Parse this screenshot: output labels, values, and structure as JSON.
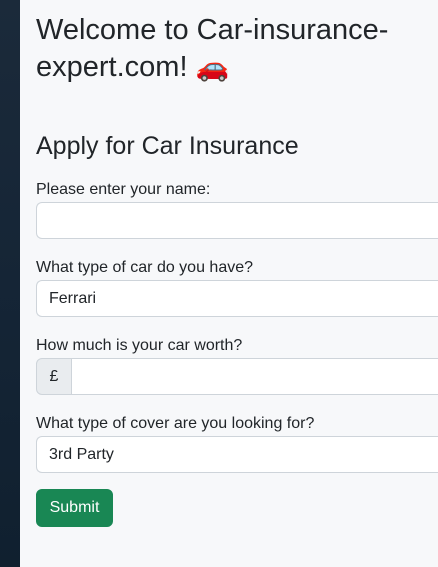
{
  "header": {
    "welcome_text": "Welcome to Car-insurance-expert.com!",
    "welcome_icon": "car-icon",
    "welcome_emoji": "🚗"
  },
  "form": {
    "title": "Apply for Car Insurance",
    "name": {
      "label": "Please enter your name:",
      "value": ""
    },
    "car_type": {
      "label": "What type of car do you have?",
      "selected": "Ferrari"
    },
    "car_worth": {
      "label": "How much is your car worth?",
      "currency_prefix": "£",
      "value": ""
    },
    "cover_type": {
      "label": "What type of cover are you looking for?",
      "selected": "3rd Party"
    },
    "submit_label": "Submit"
  },
  "colors": {
    "submit_button": "#198754",
    "sidebar": "#152536",
    "background": "#f7f8fa"
  }
}
